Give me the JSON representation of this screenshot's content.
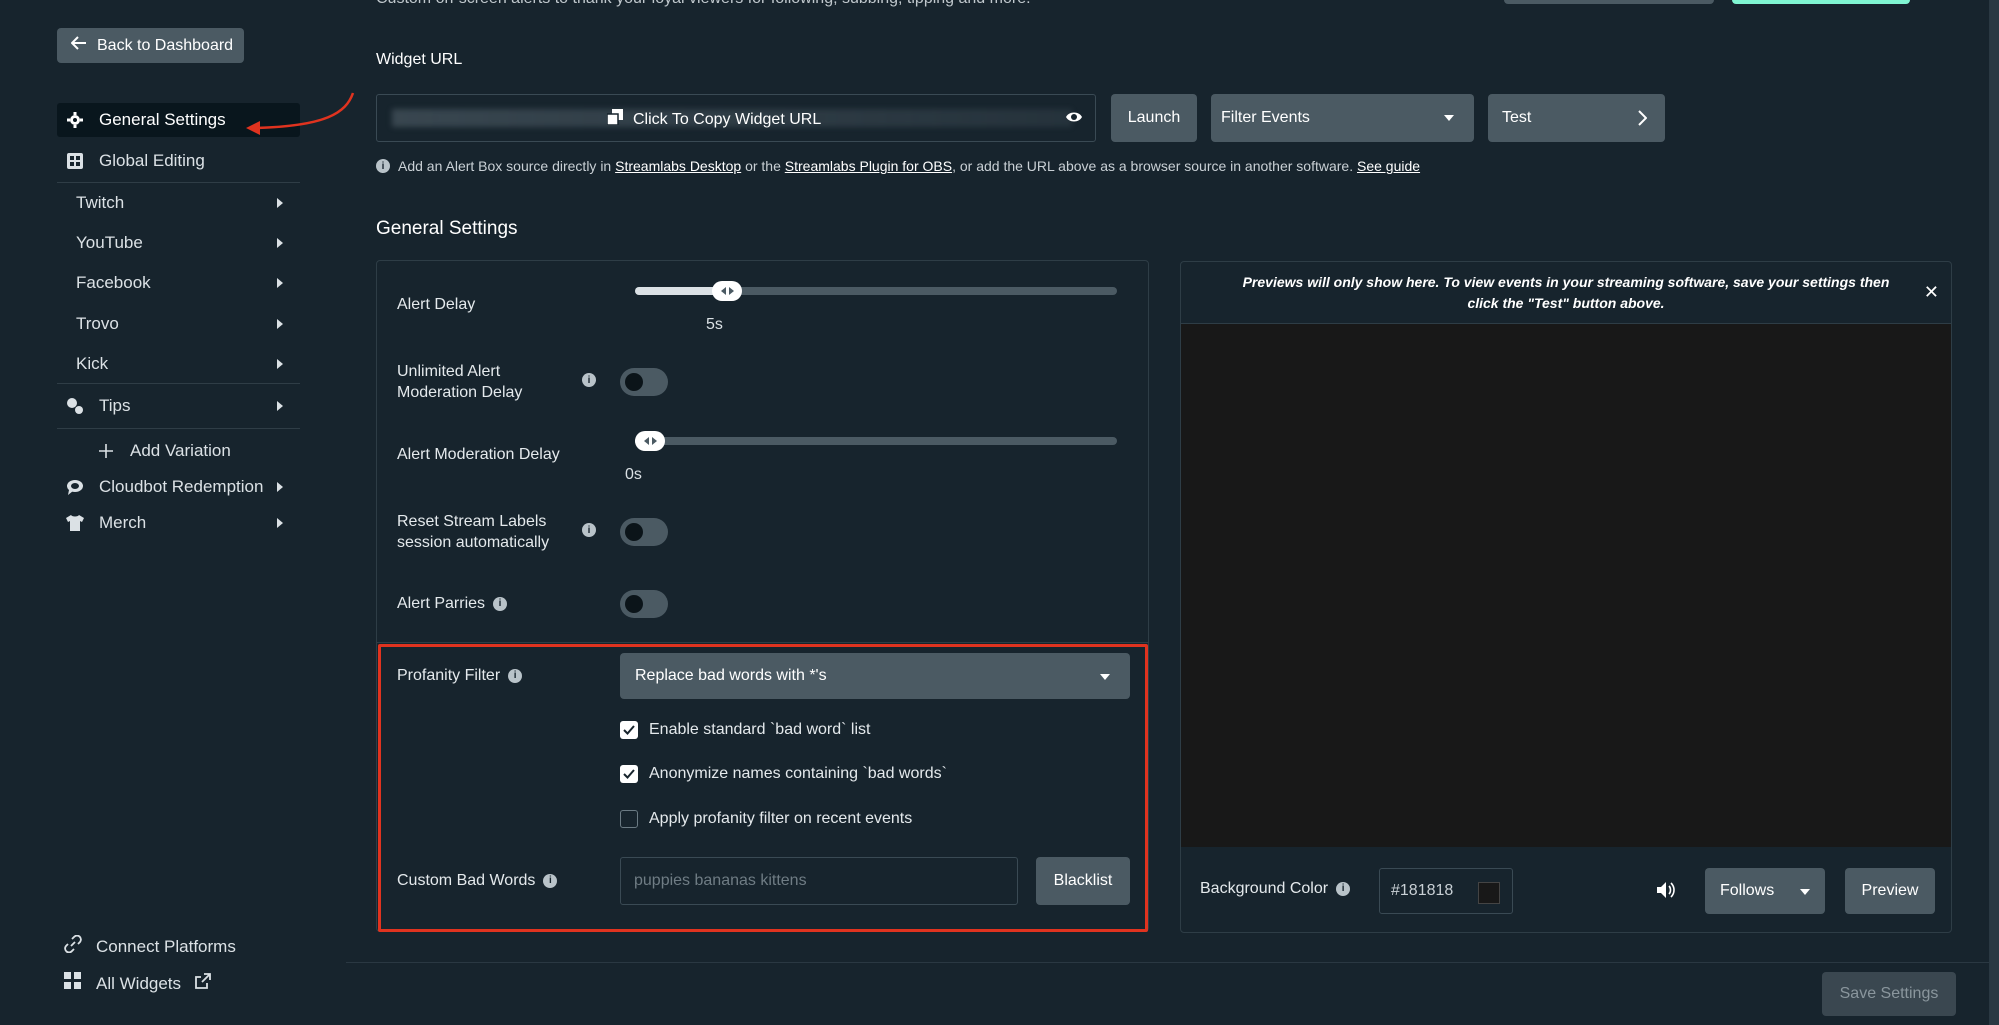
{
  "header": {
    "note": "Custom on-screen alerts to thank your loyal viewers for following, subbing, tipping and more."
  },
  "sidebar": {
    "back_label": "Back to Dashboard",
    "items": [
      {
        "label": "General Settings",
        "icon": "gear-icon"
      },
      {
        "label": "Global Editing",
        "icon": "grid-icon"
      },
      {
        "label": "Twitch"
      },
      {
        "label": "YouTube"
      },
      {
        "label": "Facebook"
      },
      {
        "label": "Trovo"
      },
      {
        "label": "Kick"
      },
      {
        "label": "Tips",
        "icon": "tips-icon"
      },
      {
        "label": "Add Variation",
        "icon": "plus-icon"
      },
      {
        "label": "Cloudbot Redemption",
        "icon": "cloudbot-icon"
      },
      {
        "label": "Merch",
        "icon": "shirt-icon"
      }
    ],
    "footer": {
      "connect": "Connect Platforms",
      "widgets": "All Widgets"
    }
  },
  "widget_url": {
    "label": "Widget URL",
    "copy_label": "Click To Copy Widget URL",
    "launch": "Launch",
    "filter": "Filter Events",
    "test": "Test",
    "help_prefix": "Add an Alert Box source directly in",
    "help_link1": "Streamlabs Desktop",
    "help_mid": "or the",
    "help_link2": "Streamlabs Plugin for OBS",
    "help_suffix": ", or add the URL above as a browser source in another software.",
    "help_link3": "See guide"
  },
  "general": {
    "title": "General Settings",
    "alert_delay": {
      "label": "Alert Delay",
      "value": "5s",
      "fraction": 0.17
    },
    "unlimited_moderation": {
      "label_line1": "Unlimited Alert",
      "label_line2": "Moderation Delay",
      "on": false
    },
    "moderation_delay": {
      "label": "Alert Moderation Delay",
      "value": "0s",
      "fraction": 0.0
    },
    "reset_labels": {
      "label_line1": "Reset Stream Labels",
      "label_line2": "session automatically",
      "on": false
    },
    "alert_parries": {
      "label": "Alert Parries",
      "on": false
    },
    "profanity": {
      "label": "Profanity Filter",
      "selected": "Replace bad words with *'s",
      "checks": [
        {
          "label": "Enable standard `bad word` list",
          "checked": true
        },
        {
          "label": "Anonymize names containing `bad words`",
          "checked": true
        },
        {
          "label": "Apply profanity filter on recent events",
          "checked": false
        }
      ]
    },
    "custom_words": {
      "label": "Custom Bad Words",
      "placeholder": "puppies bananas kittens",
      "button": "Blacklist"
    }
  },
  "preview": {
    "note": "Previews will only show here. To view events in your streaming software, save your settings then click the \"Test\" button above.",
    "bg_label": "Background Color",
    "bg_value": "#181818",
    "event_select": "Follows",
    "preview_button": "Preview"
  },
  "save_button": "Save Settings"
}
